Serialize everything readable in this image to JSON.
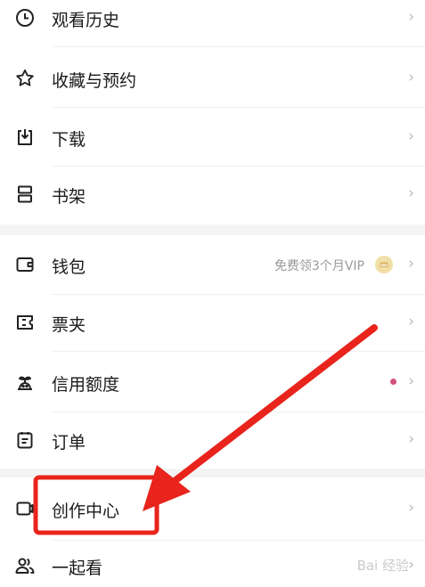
{
  "menu_group_1": [
    {
      "label": "观看历史",
      "icon": "clock-icon"
    },
    {
      "label": "收藏与预约",
      "icon": "star-icon"
    },
    {
      "label": "下载",
      "icon": "download-icon"
    },
    {
      "label": "书架",
      "icon": "bookshelf-icon"
    }
  ],
  "menu_group_2": [
    {
      "label": "钱包",
      "icon": "wallet-icon",
      "aux": "免费领3个月VIP"
    },
    {
      "label": "票夹",
      "icon": "ticket-icon"
    },
    {
      "label": "信用额度",
      "icon": "credit-icon"
    },
    {
      "label": "订单",
      "icon": "order-icon"
    }
  ],
  "menu_group_3": [
    {
      "label": "创作中心",
      "icon": "creator-icon"
    },
    {
      "label": "一起看",
      "icon": "watch-together-icon"
    }
  ],
  "chevron": "›",
  "watermark": "Bai 经验",
  "colors": {
    "annotation": "#e8241c",
    "dot": "#d4517a",
    "badge": "#f2dfa8"
  }
}
